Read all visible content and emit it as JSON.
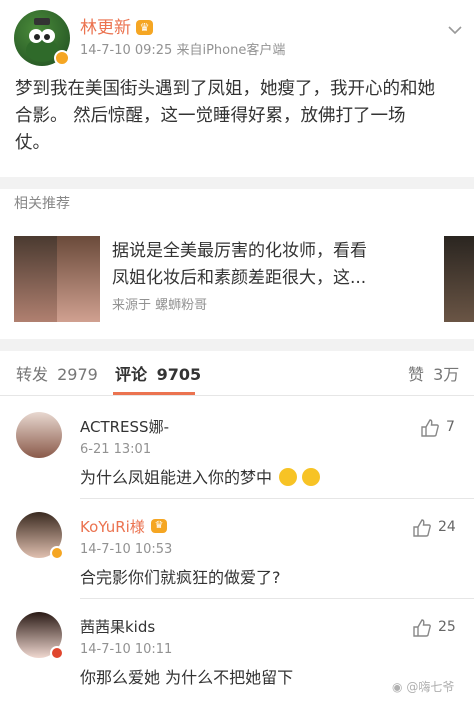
{
  "post": {
    "author": "林更新",
    "meta": "14-7-10 09:25  来自iPhone客户端",
    "text_line1": "梦到我在美国街头遇到了凤姐，她瘦了，我开心的和她",
    "text_line2": "合影。 然后惊醒，这一觉睡得好累，放佛打了一场",
    "text_line3": "仗。"
  },
  "related": {
    "header": "相关推荐",
    "title_line1": "据说是全美最厉害的化妆师，看看",
    "title_line2": "凤姐化妆后和素颜差距很大，这...",
    "source": "来源于  螺蛳粉哥"
  },
  "tabs": {
    "repost_label": "转发",
    "repost_count": "2979",
    "comment_label": "评论",
    "comment_count": "9705",
    "like_label": "赞",
    "like_count": "3万"
  },
  "comments": [
    {
      "name": "ACTRESS娜-",
      "time": "6-21 13:01",
      "text": "为什么凤姐能进入你的梦中",
      "likes": "7"
    },
    {
      "name": "KoYuRi様",
      "time": "14-7-10 10:53",
      "text": "合完影你们就疯狂的做爱了?",
      "likes": "24"
    },
    {
      "name": "茜茜果kids",
      "time": "14-7-10 10:11",
      "text": "你那么爱她 为什么不把她留下",
      "likes": "25"
    }
  ],
  "watermark": "@嗨七爷",
  "colors": {
    "accent": "#eb7350",
    "vip_badge": "#f5a623"
  }
}
